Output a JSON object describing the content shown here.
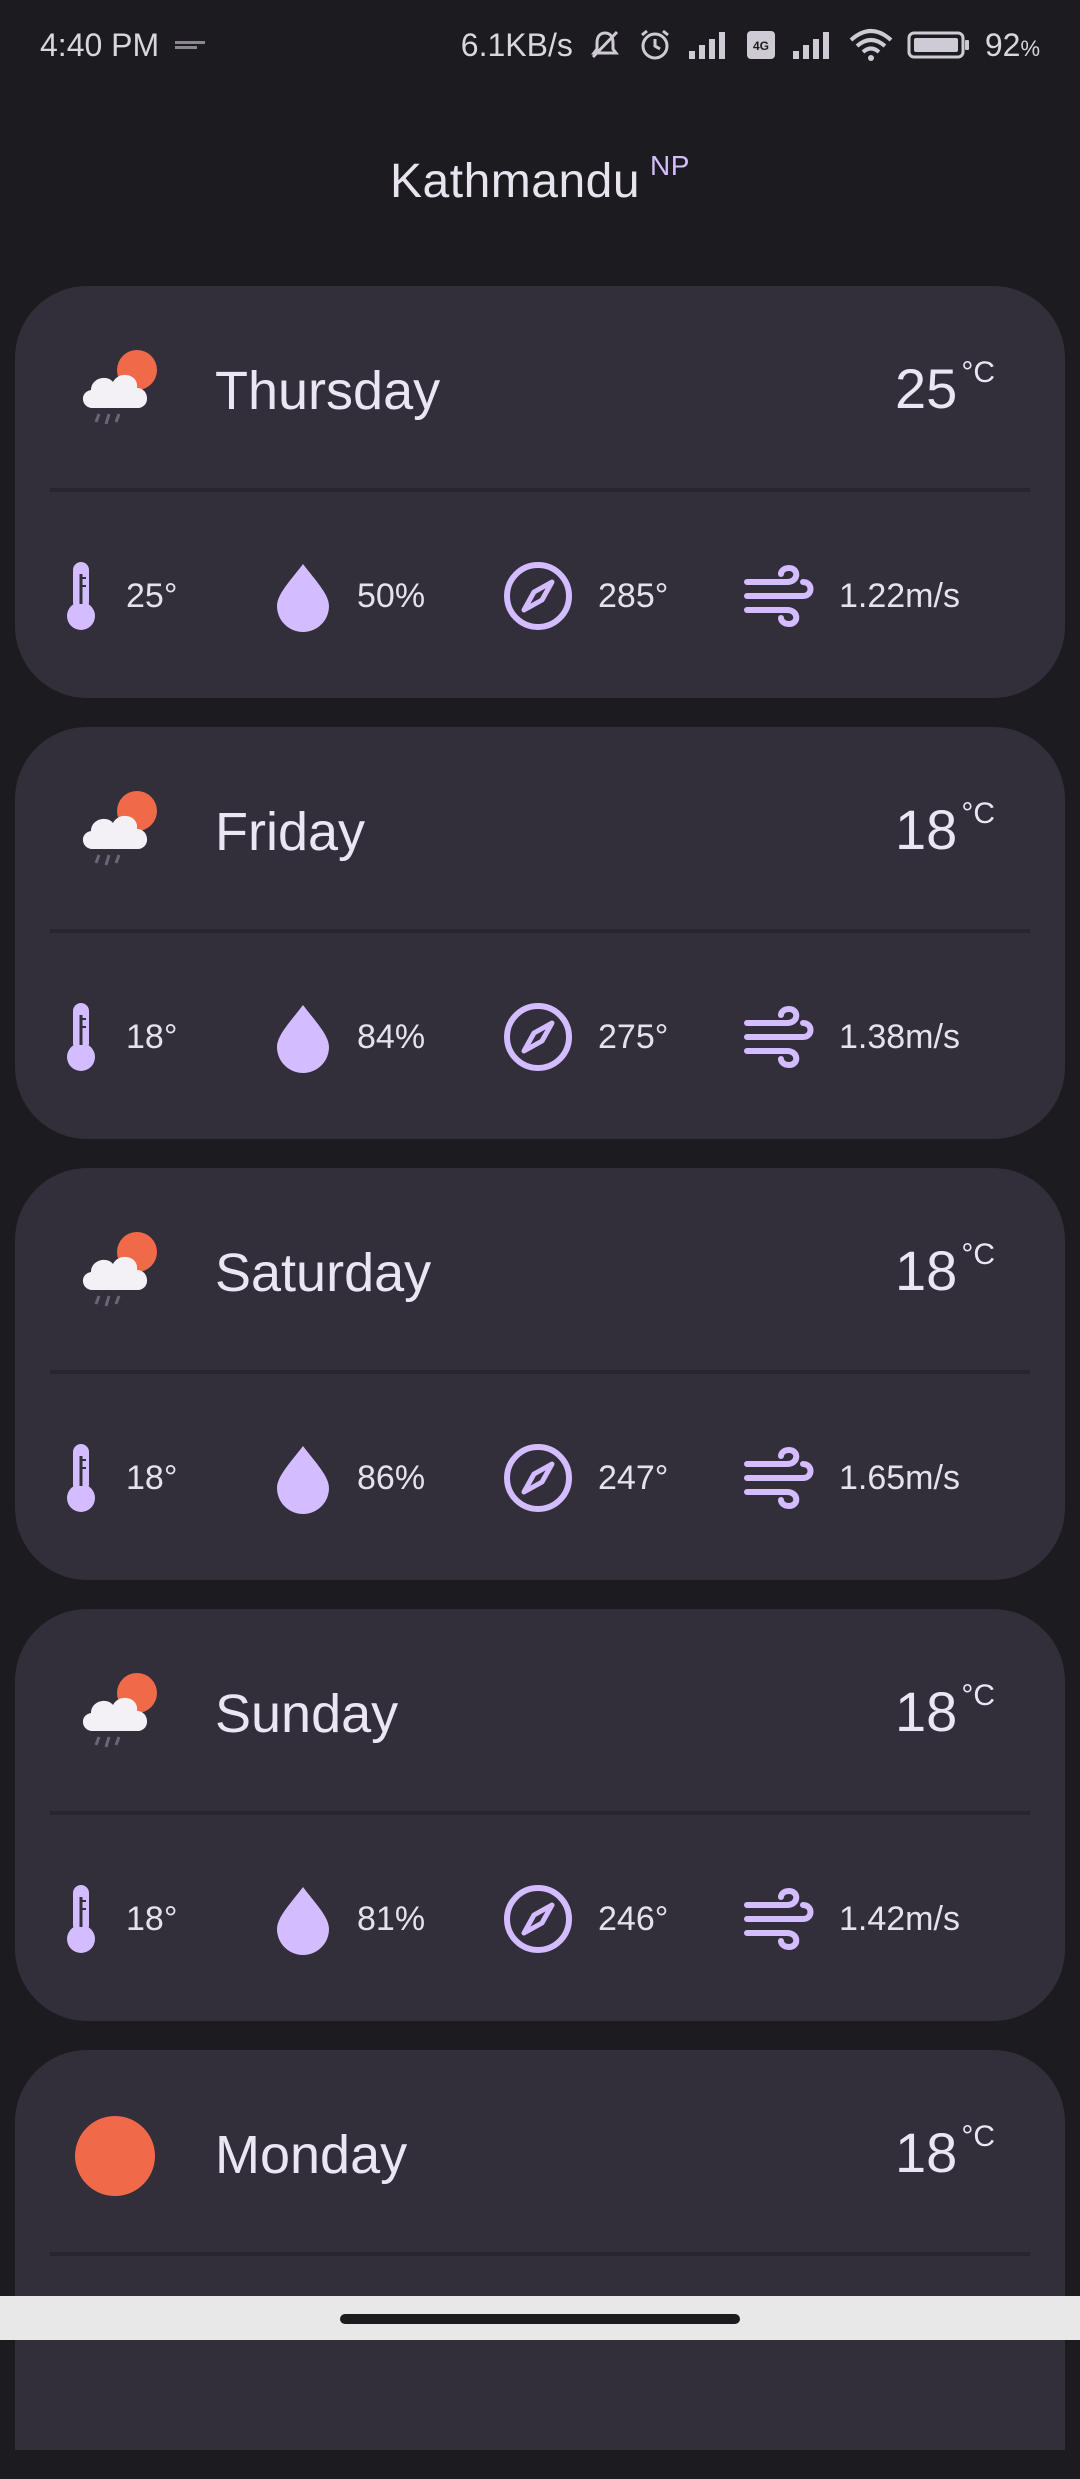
{
  "status_bar": {
    "time": "4:40 PM",
    "net_speed": "6.1KB/s",
    "battery": "92"
  },
  "header": {
    "city": "Kathmandu",
    "country": "NP"
  },
  "forecast": [
    {
      "day": "Thursday",
      "temp": "25",
      "unit": "°C",
      "icon": "cloud-rain-sun-icon",
      "min": "25°",
      "humidity": "50%",
      "direction": "285°",
      "wind": "1.22m/s"
    },
    {
      "day": "Friday",
      "temp": "18",
      "unit": "°C",
      "icon": "cloud-rain-sun-icon",
      "min": "18°",
      "humidity": "84%",
      "direction": "275°",
      "wind": "1.38m/s"
    },
    {
      "day": "Saturday",
      "temp": "18",
      "unit": "°C",
      "icon": "cloud-rain-sun-icon",
      "min": "18°",
      "humidity": "86%",
      "direction": "247°",
      "wind": "1.65m/s"
    },
    {
      "day": "Sunday",
      "temp": "18",
      "unit": "°C",
      "icon": "cloud-rain-sun-icon",
      "min": "18°",
      "humidity": "81%",
      "direction": "246°",
      "wind": "1.42m/s"
    },
    {
      "day": "Monday",
      "temp": "18",
      "unit": "°C",
      "icon": "sun-icon"
    }
  ],
  "colors": {
    "background": "#1c1b20",
    "card": "#322f3a",
    "accent": "#d3bcff",
    "sun": "#f06a4a"
  }
}
